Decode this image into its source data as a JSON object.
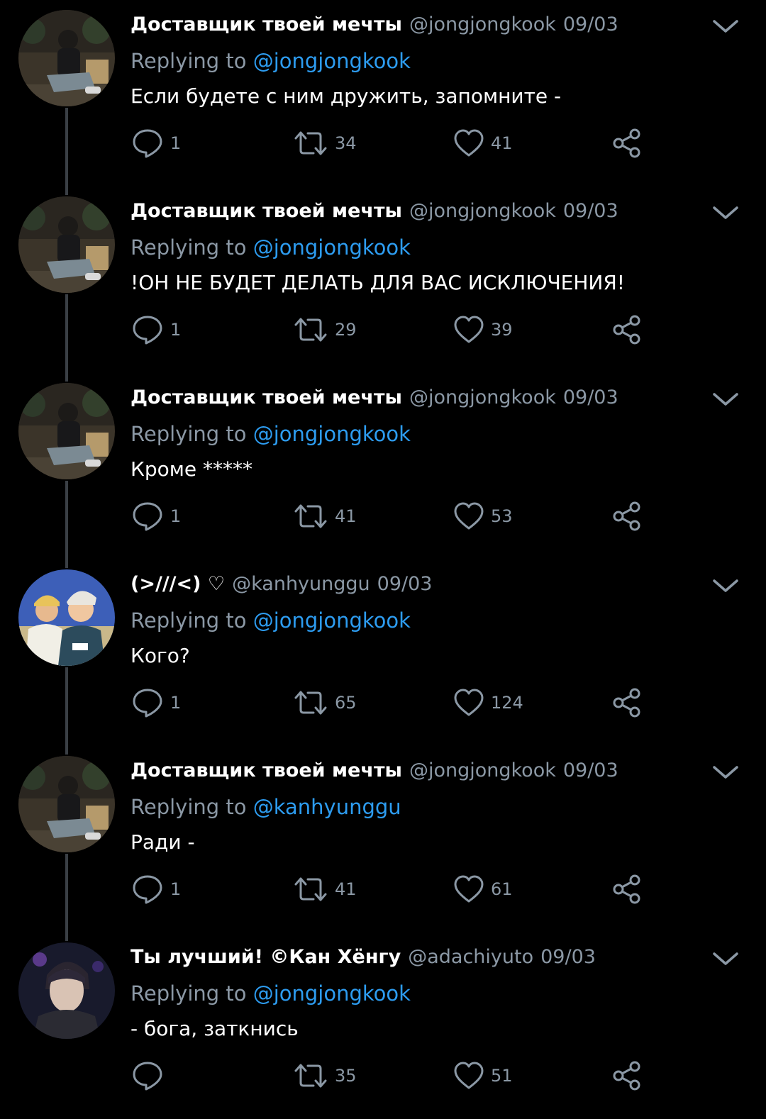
{
  "tweets": [
    {
      "name": "Доставщик твоей мечты",
      "handle": "@jongjongkook",
      "date": "09/03",
      "reply_prefix": "Replying to",
      "reply_to": "@jongjongkook",
      "text": "Если будете с ним дружить, запомните -",
      "replies": "1",
      "retweets": "34",
      "likes": "41",
      "avatar": "photo-sitting-man"
    },
    {
      "name": "Доставщик твоей мечты",
      "handle": "@jongjongkook",
      "date": "09/03",
      "reply_prefix": "Replying to",
      "reply_to": "@jongjongkook",
      "text": "!ОН НЕ БУДЕТ ДЕЛАТЬ ДЛЯ ВАС ИСКЛЮЧЕНИЯ!",
      "replies": "1",
      "retweets": "29",
      "likes": "39",
      "avatar": "photo-sitting-man"
    },
    {
      "name": "Доставщик твоей мечты",
      "handle": "@jongjongkook",
      "date": "09/03",
      "reply_prefix": "Replying to",
      "reply_to": "@jongjongkook",
      "text": "Кроме *****",
      "replies": "1",
      "retweets": "41",
      "likes": "53",
      "avatar": "photo-sitting-man"
    },
    {
      "name": "(>///<) ♡",
      "handle": "@kanhyunggu",
      "date": "09/03",
      "reply_prefix": "Replying to",
      "reply_to": "@jongjongkook",
      "text": "Кого?",
      "replies": "1",
      "retweets": "65",
      "likes": "124",
      "avatar": "photo-two-people"
    },
    {
      "name": "Доставщик твоей мечты",
      "handle": "@jongjongkook",
      "date": "09/03",
      "reply_prefix": "Replying to",
      "reply_to": "@kanhyunggu",
      "text": "Ради -",
      "replies": "1",
      "retweets": "41",
      "likes": "61",
      "avatar": "photo-sitting-man"
    },
    {
      "name": "Ты лучший!  ©Кан Хёнгу",
      "handle": "@adachiyuto",
      "date": "09/03",
      "reply_prefix": "Replying to",
      "reply_to": "@jongjongkook",
      "text": "- бога, заткнись",
      "replies": "",
      "retweets": "35",
      "likes": "51",
      "avatar": "photo-portrait"
    }
  ],
  "colors": {
    "background": "#000000",
    "text": "#ffffff",
    "muted": "#8b98a5",
    "accent": "#2d9cf0",
    "thread_line": "#3a3f45"
  },
  "icons": {
    "reply": "reply-icon",
    "retweet": "retweet-icon",
    "like": "heart-icon",
    "share": "share-icon",
    "menu": "chevron-down-icon"
  }
}
